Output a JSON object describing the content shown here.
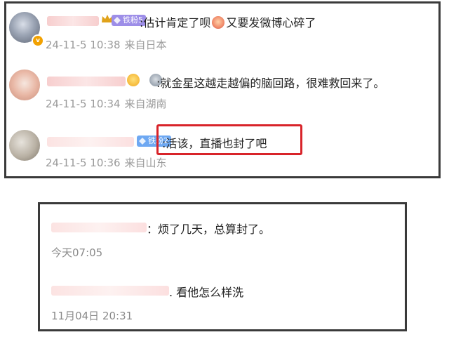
{
  "weibo_comments": [
    {
      "fan_badge": "铁粉5",
      "text_prefix": ":估计肯定了呗",
      "text_suffix": "又要发微博心碎了",
      "date": "24-11-5 10:38",
      "location": "来自日本"
    },
    {
      "text": ":就金星这越走越偏的脑回路，很难救回来了。",
      "date": "24-11-5 10:34",
      "location": "来自湖南"
    },
    {
      "fan_badge": "铁粉2",
      "text": ":活该，直播也封了吧",
      "date": "24-11-5 10:36",
      "location": "来自山东"
    }
  ],
  "other_comments": [
    {
      "text": "：烦了几天，总算封了。",
      "time": "今天07:05"
    },
    {
      "text": ". 看他怎么样洗",
      "time": "11月04日 20:31"
    }
  ],
  "colors": {
    "highlight": "#d8242a",
    "meta_gray": "#9a9a9a",
    "border": "#3a3a3a"
  }
}
